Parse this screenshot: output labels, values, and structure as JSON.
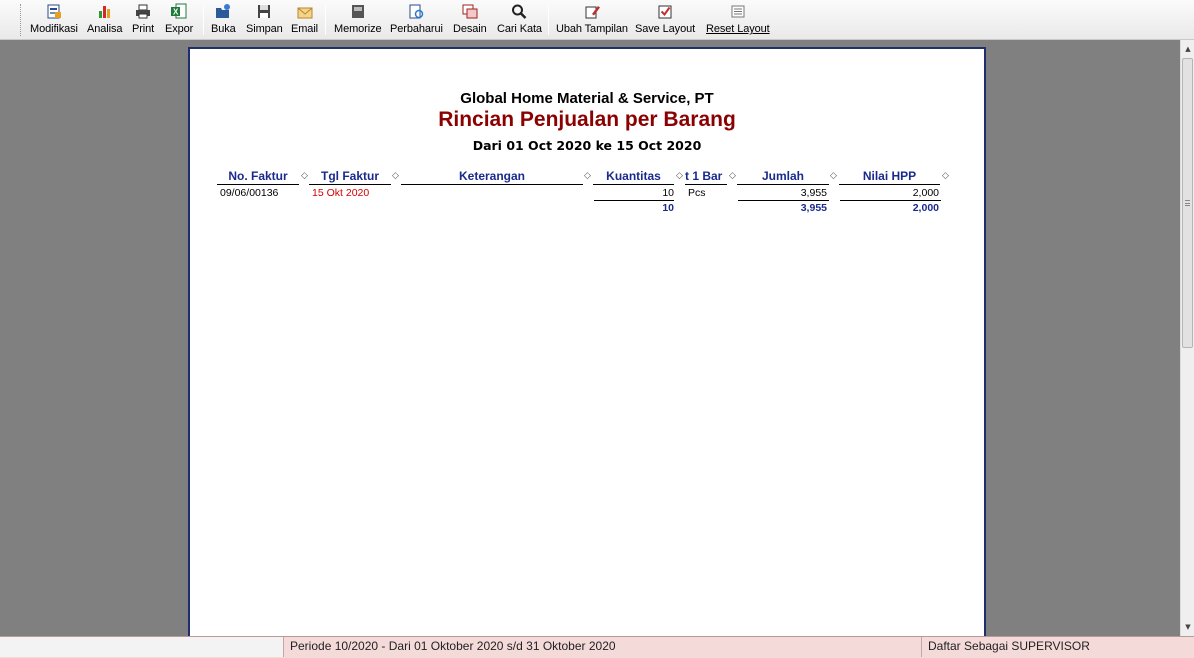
{
  "toolbar": {
    "buttons": [
      {
        "label": "Modifikasi",
        "icon": "modify-icon"
      },
      {
        "label": "Analisa",
        "icon": "bar-chart-icon"
      },
      {
        "label": "Print",
        "icon": "printer-icon"
      },
      {
        "label": "Expor",
        "icon": "excel-icon"
      },
      {
        "label": "Buka",
        "icon": "folder-open-icon"
      },
      {
        "label": "Simpan",
        "icon": "floppy-disk-icon"
      },
      {
        "label": "Email",
        "icon": "envelope-icon"
      },
      {
        "label": "Memorize",
        "icon": "memorize-icon"
      },
      {
        "label": "Perbaharui",
        "icon": "refresh-icon"
      },
      {
        "label": "Desain",
        "icon": "design-icon"
      },
      {
        "label": "Cari Kata",
        "icon": "search-icon"
      },
      {
        "label": "Ubah Tampilan",
        "icon": "edit-pencil-icon"
      },
      {
        "label": "Save Layout",
        "icon": "checkbox-icon"
      },
      {
        "label": "Reset Layout",
        "icon": "layout-icon"
      }
    ]
  },
  "report": {
    "company": "Global Home Material & Service, PT",
    "title": "Rincian Penjualan per Barang",
    "period": "Dari 01 Oct 2020 ke 15 Oct 2020",
    "columns": [
      "No. Faktur",
      "Tgl Faktur",
      "Keterangan",
      "Kuantitas",
      "t 1 Bar",
      "Jumlah",
      "Nilai HPP"
    ],
    "rows": [
      {
        "no_faktur": "09/06/00136",
        "tgl_faktur": "15 Okt 2020",
        "keterangan": "",
        "kuantitas": "10",
        "unit": "Pcs",
        "jumlah": "3,955",
        "nilai_hpp": "2,000"
      }
    ],
    "totals": {
      "kuantitas": "10",
      "jumlah": "3,955",
      "nilai_hpp": "2,000"
    }
  },
  "statusbar": {
    "left": "",
    "period": "Periode 10/2020 - Dari 01 Oktober 2020 s/d 31 Oktober 2020",
    "user": "Daftar Sebagai SUPERVISOR"
  },
  "colors": {
    "title": "#8b0000",
    "header": "#1a2a8c",
    "date": "#d40000",
    "status_bg": "#f5dada"
  }
}
